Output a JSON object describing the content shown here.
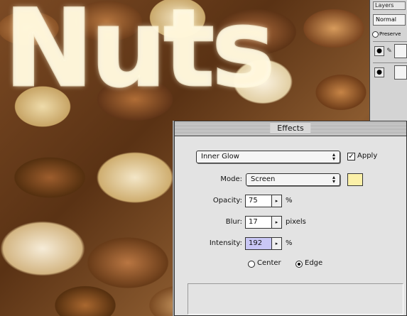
{
  "canvas": {
    "text_layer": "Nuts"
  },
  "layers_palette": {
    "tab_label": "Layers",
    "blend_mode": "Normal",
    "preserve_label": "Preserve"
  },
  "effects_dialog": {
    "title": "Effects",
    "effect_type": "Inner Glow",
    "apply_label": "Apply",
    "apply_checked": true,
    "mode_label": "Mode:",
    "mode_value": "Screen",
    "glow_color": "#fbf0a8",
    "opacity_label": "Opacity:",
    "opacity_value": "75",
    "opacity_unit": "%",
    "blur_label": "Blur:",
    "blur_value": "17",
    "blur_unit": "pixels",
    "intensity_label": "Intensity:",
    "intensity_value": "192",
    "intensity_unit": "%",
    "source_options": [
      "Center",
      "Edge"
    ],
    "source_selected": "Edge"
  }
}
